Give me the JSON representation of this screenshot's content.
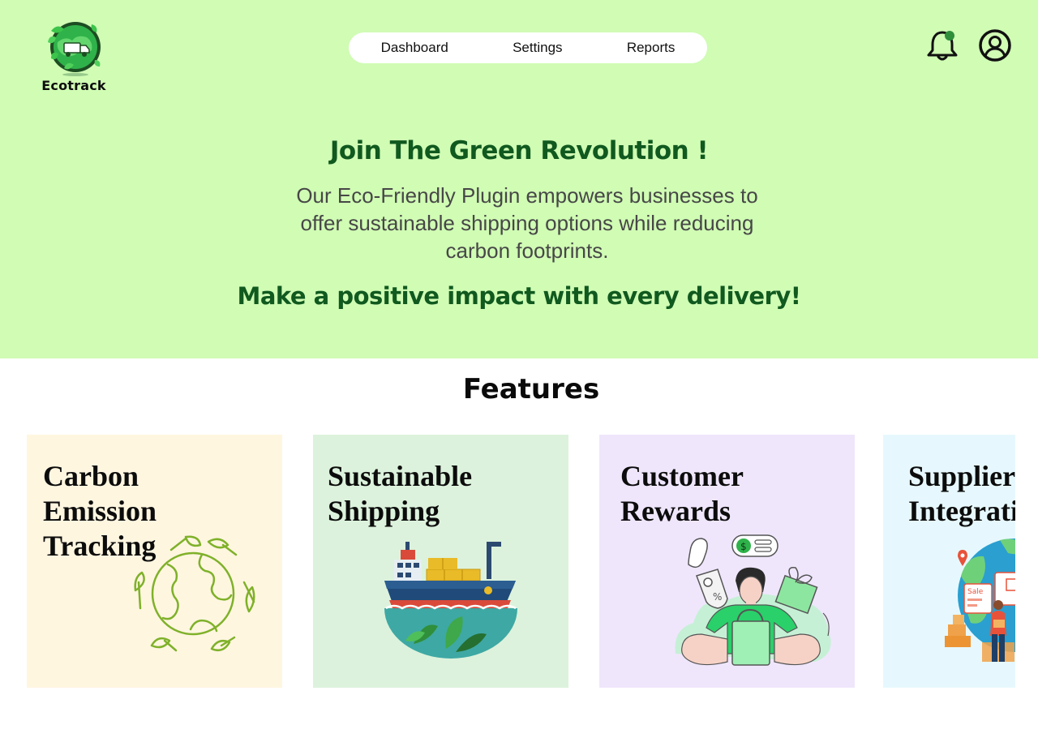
{
  "brand": {
    "name": "Ecotrack"
  },
  "nav": {
    "items": [
      {
        "label": "Dashboard"
      },
      {
        "label": "Settings"
      },
      {
        "label": "Reports"
      }
    ]
  },
  "header_icons": [
    "bell-icon",
    "user-profile-icon"
  ],
  "hero": {
    "title": "Join The Green Revolution !",
    "description": "Our Eco-Friendly Plugin empowers businesses to offer sustainable shipping options while reducing carbon footprints.",
    "cta": "Make a positive impact with every delivery!"
  },
  "features": {
    "title": "Features",
    "cards": [
      {
        "title": "Carbon\nEmission\nTracking",
        "bg": "#fff6e0",
        "icon": "earth-leaves-icon"
      },
      {
        "title": "Sustainable\nShipping",
        "bg": "#dcf2dc",
        "icon": "cargo-ship-icon"
      },
      {
        "title": "Customer\nRewards",
        "bg": "#efe6fc",
        "icon": "reward-shopper-illustration"
      },
      {
        "title": "Supplier\nIntegration",
        "bg": "#e6f8fd",
        "icon": "globe-supplier-illustration"
      }
    ]
  },
  "colors": {
    "hero_bg": "#d0fcb4",
    "headline_green": "#10591f",
    "notification_dot": "#2f8f3a"
  }
}
